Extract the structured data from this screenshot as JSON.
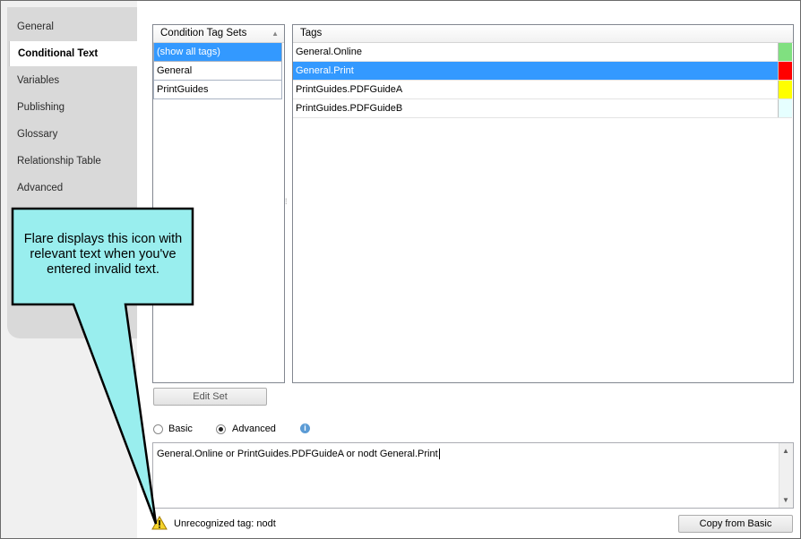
{
  "sidebar": {
    "tabs": [
      {
        "label": "General",
        "active": false
      },
      {
        "label": "Conditional Text",
        "active": true
      },
      {
        "label": "Variables",
        "active": false
      },
      {
        "label": "Publishing",
        "active": false
      },
      {
        "label": "Glossary",
        "active": false
      },
      {
        "label": "Relationship Table",
        "active": false
      },
      {
        "label": "Advanced",
        "active": false
      }
    ]
  },
  "tag_sets": {
    "header": "Condition Tag Sets",
    "rows": [
      "(show all tags)",
      "General",
      "PrintGuides"
    ],
    "selected_index": 0
  },
  "tags": {
    "header": "Tags",
    "rows": [
      {
        "name": "General.Online",
        "color": "#80e080"
      },
      {
        "name": "General.Print",
        "color": "#ff0000"
      },
      {
        "name": "PrintGuides.PDFGuideA",
        "color": "#ffff00"
      },
      {
        "name": "PrintGuides.PDFGuideB",
        "color": "#e6ffff"
      }
    ],
    "selected_index": 1
  },
  "buttons": {
    "edit_set": "Edit Set",
    "copy_from_basic": "Copy from Basic"
  },
  "mode": {
    "basic_label": "Basic",
    "advanced_label": "Advanced",
    "selected": "Advanced"
  },
  "expression": {
    "value": "General.Online or PrintGuides.PDFGuideA or nodt General.Print"
  },
  "validation": {
    "message": "Unrecognized tag: nodt"
  },
  "callout": {
    "text": "Flare displays this icon with relevant text when you've entered invalid text.",
    "fill": "#99eeee"
  }
}
